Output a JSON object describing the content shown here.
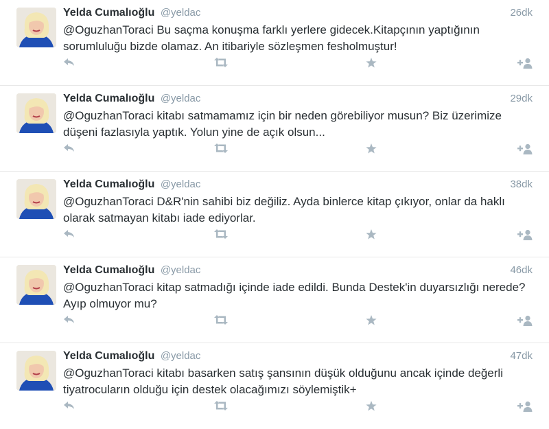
{
  "tweets": [
    {
      "fullname": "Yelda Cumalıoğlu",
      "username": "@yeldac",
      "time": "26dk",
      "text": "@OguzhanToraci Bu saçma konuşma farklı yerlere gidecek.Kitapçının yaptığının sorumluluğu bizde olamaz. An itibariyle sözleşmen fesholmuştur!"
    },
    {
      "fullname": "Yelda Cumalıoğlu",
      "username": "@yeldac",
      "time": "29dk",
      "text": "@OguzhanToraci kitabı satmamamız için bir neden görebiliyor musun? Biz üzerimize düşeni fazlasıyla yaptık. Yolun yine de açık olsun..."
    },
    {
      "fullname": "Yelda Cumalıoğlu",
      "username": "@yeldac",
      "time": "38dk",
      "text": "@OguzhanToraci D&R'nin sahibi biz değiliz. Ayda binlerce kitap çıkıyor, onlar da haklı olarak satmayan kitabı iade ediyorlar."
    },
    {
      "fullname": "Yelda Cumalıoğlu",
      "username": "@yeldac",
      "time": "46dk",
      "text": "@OguzhanToraci kitap satmadığı içinde iade edildi. Bunda Destek'in duyarsızlığı nerede? Ayıp olmuyor mu?"
    },
    {
      "fullname": "Yelda Cumalıoğlu",
      "username": "@yeldac",
      "time": "47dk",
      "text": "@OguzhanToraci kitabı basarken satış şansının düşük olduğunu ancak içinde değerli tiyatrocuların olduğu için destek olacağımızı söylemiştik+"
    }
  ],
  "icons": {
    "reply": "reply-icon",
    "retweet": "retweet-icon",
    "favorite": "star-icon",
    "follow": "follow-icon"
  },
  "colors": {
    "name": "#292f33",
    "meta": "#8899a6",
    "icon": "#aab8c2",
    "divider": "#e8e8e8"
  }
}
